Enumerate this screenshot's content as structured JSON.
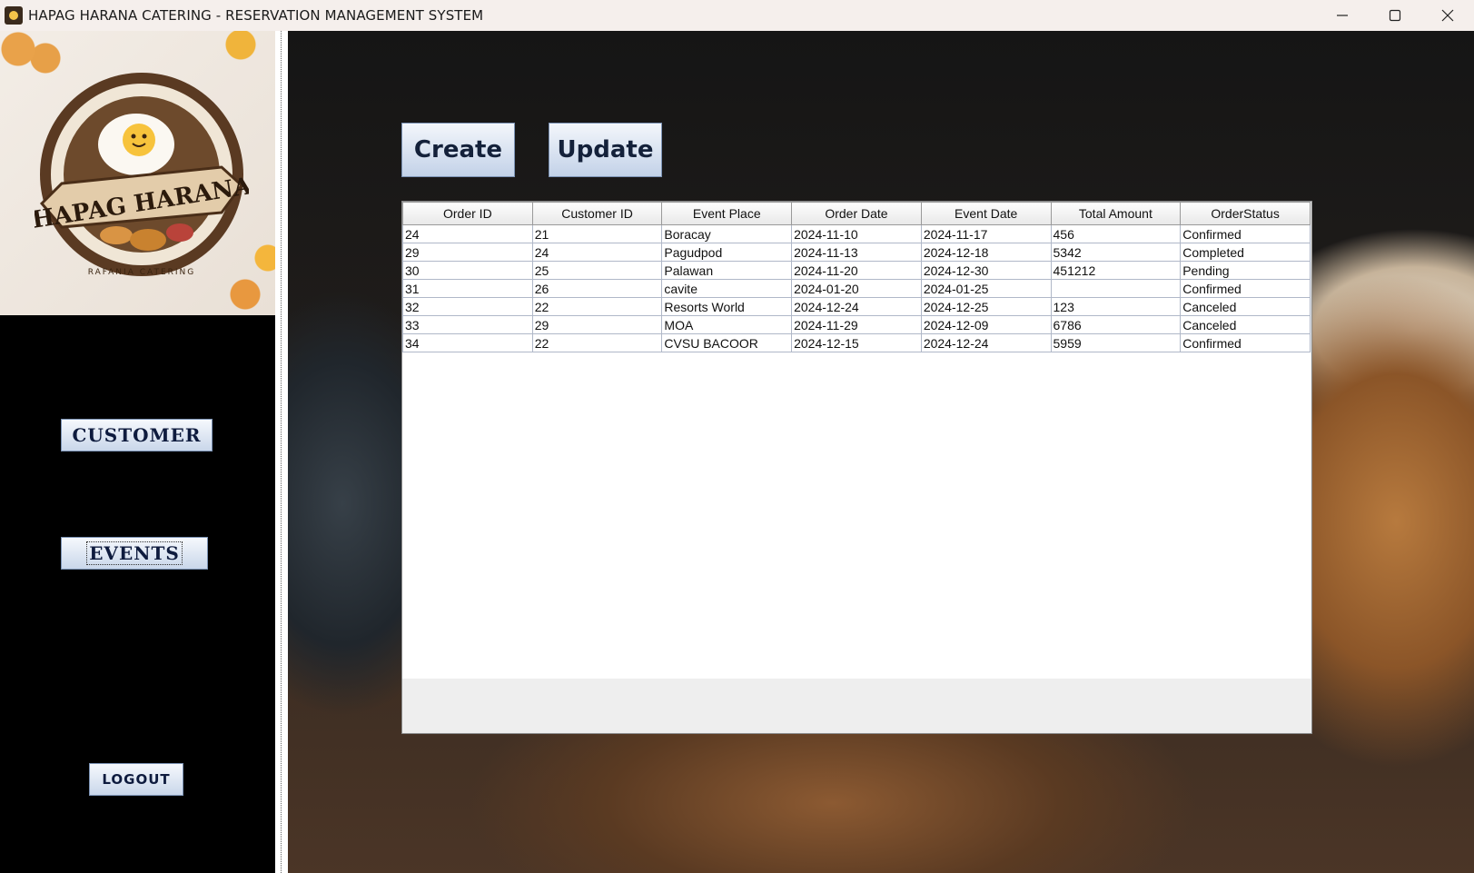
{
  "window": {
    "title": "HAPAG HARANA CATERING - RESERVATION MANAGEMENT SYSTEM",
    "controls": [
      "minimize-icon",
      "maximize-icon",
      "close-icon"
    ]
  },
  "sidebar": {
    "logo": {
      "brand_text": "HAPAG HARANA",
      "sub_text": "RAFANIA CATERING"
    },
    "buttons": {
      "customer": "CUSTOMER",
      "events": "EVENTS",
      "logout": "LOGOUT"
    }
  },
  "toolbar": {
    "create_label": "Create",
    "update_label": "Update"
  },
  "orders_table": {
    "columns": [
      "Order ID",
      "Customer ID",
      "Event Place",
      "Order Date",
      "Event Date",
      "Total Amount",
      "OrderStatus"
    ],
    "rows": [
      [
        "24",
        "21",
        "Boracay",
        "2024-11-10",
        "2024-11-17",
        "456",
        "Confirmed"
      ],
      [
        "29",
        "24",
        "Pagudpod",
        "2024-11-13",
        "2024-12-18",
        "5342",
        "Completed"
      ],
      [
        "30",
        "25",
        "Palawan",
        "2024-11-20",
        "2024-12-30",
        "451212",
        "Pending"
      ],
      [
        "31",
        "26",
        "cavite",
        "2024-01-20",
        "2024-01-25",
        "",
        "Confirmed"
      ],
      [
        "32",
        "22",
        "Resorts World",
        "2024-12-24",
        "2024-12-25",
        "123",
        "Canceled"
      ],
      [
        "33",
        "29",
        "MOA",
        "2024-11-29",
        "2024-12-09",
        "6786",
        "Canceled"
      ],
      [
        "34",
        "22",
        "CVSU BACOOR",
        "2024-12-15",
        "2024-12-24",
        "5959",
        "Confirmed"
      ]
    ]
  }
}
